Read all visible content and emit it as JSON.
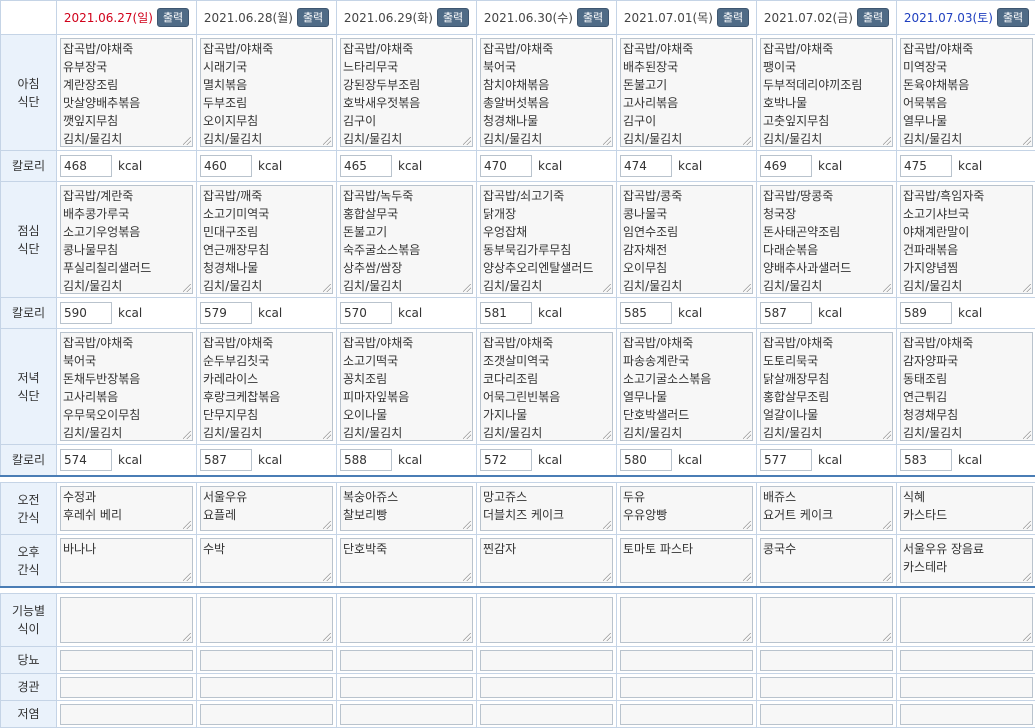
{
  "print_label": "출력",
  "kcal_unit": "kcal",
  "labels": {
    "breakfast": [
      "아침",
      "식단"
    ],
    "lunch": [
      "점심",
      "식단"
    ],
    "dinner": [
      "저녁",
      "식단"
    ],
    "calorie": "칼로리",
    "am_snack": [
      "오전",
      "간식"
    ],
    "pm_snack": [
      "오후",
      "간식"
    ],
    "functional": [
      "기능별",
      "식이"
    ],
    "diabetes": "당뇨",
    "tube": "경관",
    "lowsalt": "저염"
  },
  "days": [
    {
      "date": "2021.06.27(일)",
      "type": "sun",
      "breakfast": [
        "잡곡밥/야채죽",
        "유부장국",
        "계란장조림",
        "맛살양배추볶음",
        "깻잎지무침",
        "김치/물김치"
      ],
      "breakfast_kcal": "468",
      "lunch": [
        "잡곡밥/계란죽",
        "배추콩가루국",
        "소고기우엉볶음",
        "콩나물무침",
        "푸실리칠리샐러드",
        "김치/물김치"
      ],
      "lunch_kcal": "590",
      "dinner": [
        "잡곡밥/야채죽",
        "북어국",
        "돈채두반장볶음",
        "고사리볶음",
        "우무묵오이무침",
        "김치/물김치"
      ],
      "dinner_kcal": "574",
      "am_snack": [
        "수정과",
        "후레쉬 베리"
      ],
      "pm_snack": [
        "바나나"
      ]
    },
    {
      "date": "2021.06.28(월)",
      "type": "week",
      "breakfast": [
        "잡곡밥/야채죽",
        "시래기국",
        "멸치볶음",
        "두부조림",
        "오이지무침",
        "김치/물김치"
      ],
      "breakfast_kcal": "460",
      "lunch": [
        "잡곡밥/깨죽",
        "소고기미역국",
        "민대구조림",
        "연근깨장무침",
        "청경채나물",
        "김치/물김치"
      ],
      "lunch_kcal": "579",
      "dinner": [
        "잡곡밥/야채죽",
        "순두부김칫국",
        "카레라이스",
        "후랑크케찹볶음",
        "단무지무침",
        "김치/물김치"
      ],
      "dinner_kcal": "587",
      "am_snack": [
        "서울우유",
        "요플레"
      ],
      "pm_snack": [
        "수박"
      ]
    },
    {
      "date": "2021.06.29(화)",
      "type": "week",
      "breakfast": [
        "잡곡밥/야채죽",
        "느타리무국",
        "강된장두부조림",
        "호박새우젓볶음",
        "김구이",
        "김치/물김치"
      ],
      "breakfast_kcal": "465",
      "lunch": [
        "잡곡밥/녹두죽",
        "홍합살무국",
        "돈불고기",
        "숙주굴소스볶음",
        "상추쌈/쌈장",
        "김치/물김치"
      ],
      "lunch_kcal": "570",
      "dinner": [
        "잡곡밥/야채죽",
        "소고기떡국",
        "꽁치조림",
        "피마자잎볶음",
        "오이나물",
        "김치/물김치"
      ],
      "dinner_kcal": "588",
      "am_snack": [
        "복숭아쥬스",
        "찰보리빵"
      ],
      "pm_snack": [
        "단호박죽"
      ]
    },
    {
      "date": "2021.06.30(수)",
      "type": "week",
      "breakfast": [
        "잡곡밥/야채죽",
        "북어국",
        "참치야채볶음",
        "총알버섯볶음",
        "청경채나물",
        "김치/물김치"
      ],
      "breakfast_kcal": "470",
      "lunch": [
        "잡곡밥/쇠고기죽",
        "닭개장",
        "우엉잡채",
        "동부묵김가루무침",
        "양상추오리엔탈샐러드",
        "김치/물김치"
      ],
      "lunch_kcal": "581",
      "dinner": [
        "잡곡밥/야채죽",
        "조갯살미역국",
        "코다리조림",
        "어묵그린빈볶음",
        "가지나물",
        "김치/물김치"
      ],
      "dinner_kcal": "572",
      "am_snack": [
        "망고쥬스",
        "더블치즈 케이크"
      ],
      "pm_snack": [
        "찐감자"
      ]
    },
    {
      "date": "2021.07.01(목)",
      "type": "week",
      "breakfast": [
        "잡곡밥/야채죽",
        "배추된장국",
        "돈불고기",
        "고사리볶음",
        "김구이",
        "김치/물김치"
      ],
      "breakfast_kcal": "474",
      "lunch": [
        "잡곡밥/콩죽",
        "콩나물국",
        "임연수조림",
        "감자채전",
        "오이무침",
        "김치/물김치"
      ],
      "lunch_kcal": "585",
      "dinner": [
        "잡곡밥/야채죽",
        "파송송계란국",
        "소고기굴소스볶음",
        "열무나물",
        "단호박샐러드",
        "김치/물김치"
      ],
      "dinner_kcal": "580",
      "am_snack": [
        "두유",
        "우유앙빵"
      ],
      "pm_snack": [
        "토마토 파스타"
      ]
    },
    {
      "date": "2021.07.02(금)",
      "type": "week",
      "breakfast": [
        "잡곡밥/야채죽",
        "팽이국",
        "두부적데리야끼조림",
        "호박나물",
        "고춧잎지무침",
        "김치/물김치"
      ],
      "breakfast_kcal": "469",
      "lunch": [
        "잡곡밥/땅콩죽",
        "청국장",
        "돈사태곤약조림",
        "다래순볶음",
        "양배추사과샐러드",
        "김치/물김치"
      ],
      "lunch_kcal": "587",
      "dinner": [
        "잡곡밥/야채죽",
        "도토리묵국",
        "닭살깨장무침",
        "홍합살무조림",
        "얼갈이나물",
        "김치/물김치"
      ],
      "dinner_kcal": "577",
      "am_snack": [
        "배쥬스",
        "요거트 케이크"
      ],
      "pm_snack": [
        "콩국수"
      ]
    },
    {
      "date": "2021.07.03(토)",
      "type": "sat",
      "breakfast": [
        "잡곡밥/야채죽",
        "미역장국",
        "돈육야채볶음",
        "어묵볶음",
        "열무나물",
        "김치/물김치"
      ],
      "breakfast_kcal": "475",
      "lunch": [
        "잡곡밥/흑임자죽",
        "소고기샤브국",
        "야채계란말이",
        "건파래볶음",
        "가지양념찜",
        "김치/물김치"
      ],
      "lunch_kcal": "589",
      "dinner": [
        "잡곡밥/야채죽",
        "감자양파국",
        "동태조림",
        "연근튀김",
        "청경채무침",
        "김치/물김치"
      ],
      "dinner_kcal": "583",
      "am_snack": [
        "식혜",
        "카스타드"
      ],
      "pm_snack": [
        "서울우유 장음료",
        "카스테라"
      ]
    }
  ]
}
